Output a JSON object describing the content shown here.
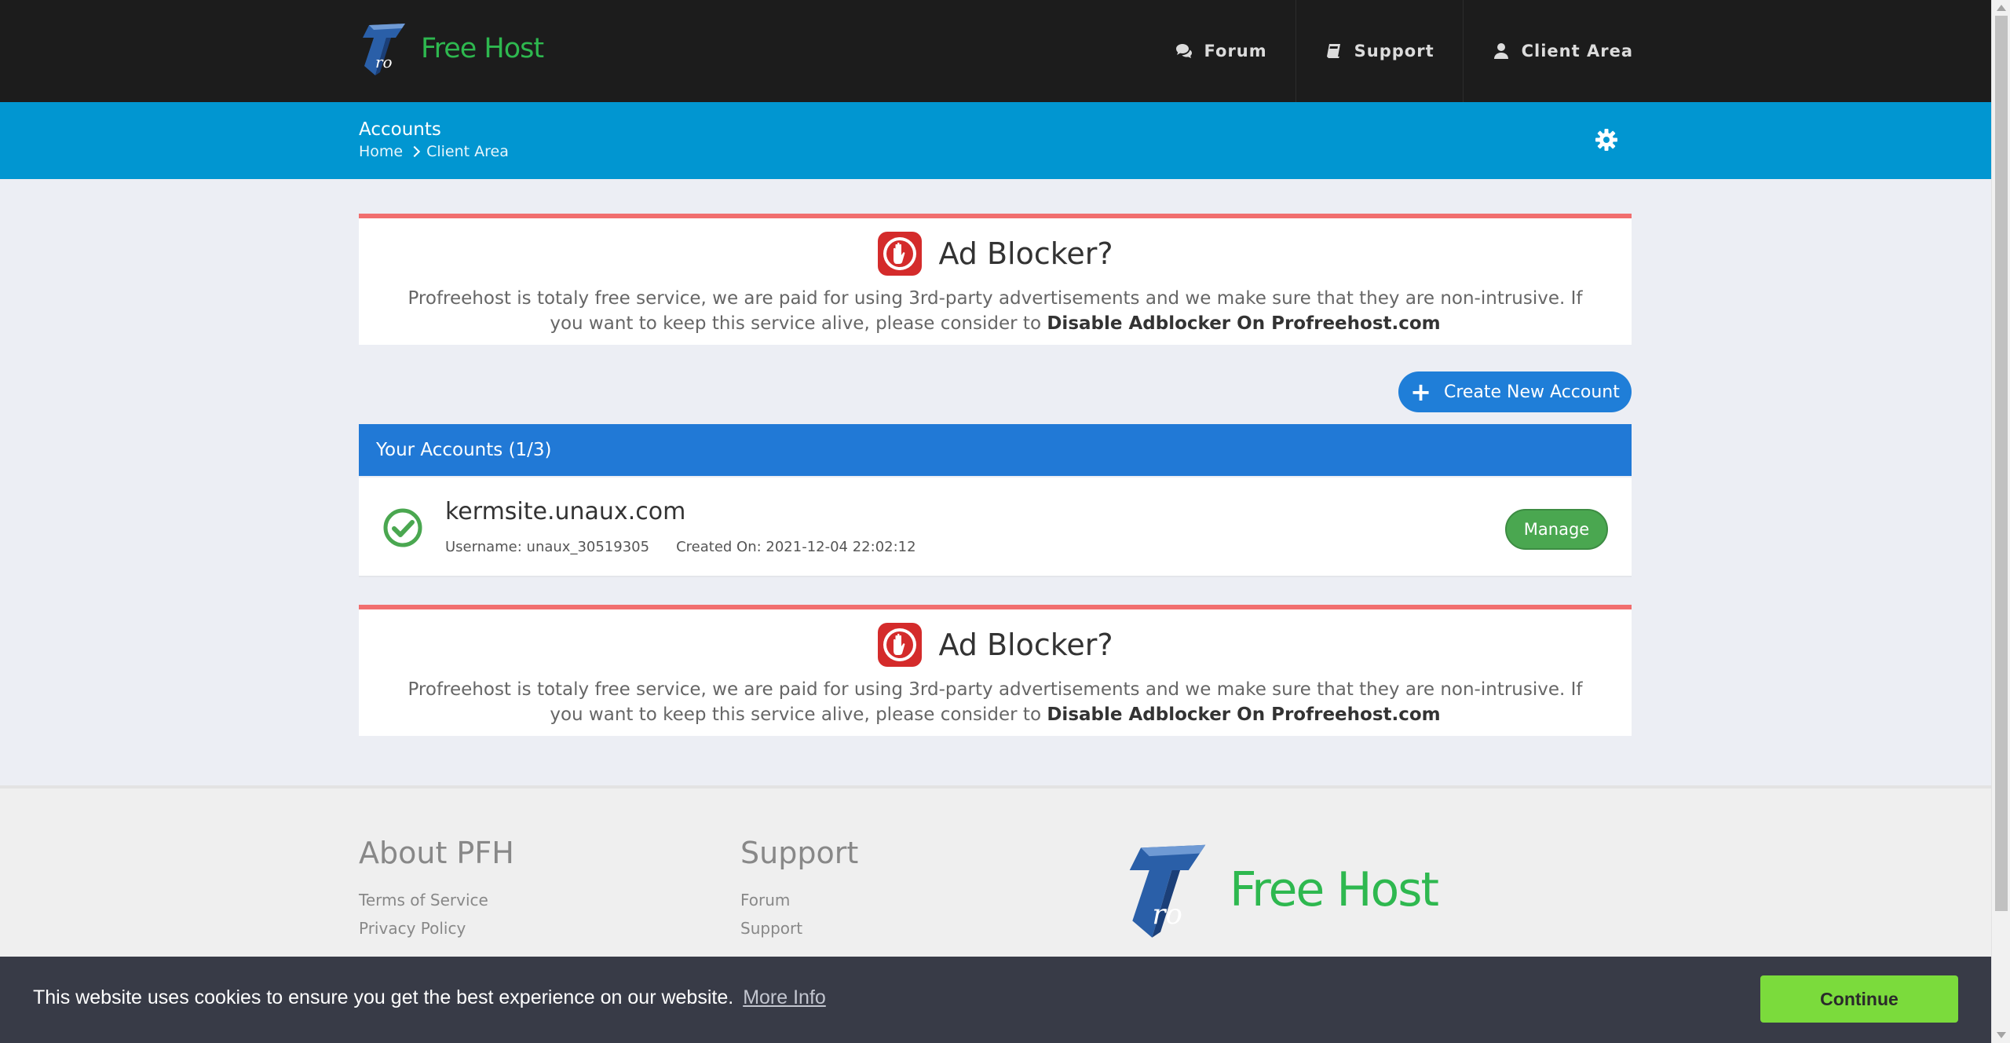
{
  "brand": {
    "logo_mark": "ro",
    "name": "Free Host",
    "color": "#2eb84f"
  },
  "nav": {
    "items": [
      {
        "label": "Forum",
        "icon": "comments-icon"
      },
      {
        "label": "Support",
        "icon": "book-icon"
      },
      {
        "label": "Client Area",
        "icon": "user-icon"
      }
    ]
  },
  "subheader": {
    "title": "Accounts",
    "breadcrumbs": [
      "Home",
      "Client Area"
    ]
  },
  "adblock": {
    "title": "Ad Blocker?",
    "text": "Profreehost is totaly free service, we are paid for using 3rd-party advertisements and we make sure that they are non-intrusive. If you want to keep this service alive, please consider to",
    "strong": "Disable Adblocker On Profreehost.com"
  },
  "accounts": {
    "create_label": "Create New Account",
    "header": "Your Accounts (1/3)",
    "items": [
      {
        "domain": "kermsite.unaux.com",
        "username": "Username: unaux_30519305",
        "created": "Created On: 2021-12-04 22:02:12",
        "status": "active",
        "manage_label": "Manage"
      }
    ]
  },
  "footer": {
    "about": {
      "title": "About PFH",
      "links": [
        "Terms of Service",
        "Privacy Policy"
      ]
    },
    "support": {
      "title": "Support",
      "links": [
        "Forum",
        "Support"
      ]
    }
  },
  "cookie": {
    "message": "This website uses cookies to ensure you get the best experience on our website.",
    "more_info": "More Info",
    "continue": "Continue"
  },
  "colors": {
    "topbar": "#1c1c1c",
    "subbar": "#0196d1",
    "accounts_header": "#2179d6",
    "adblock_border": "#f16e6e",
    "manage": "#4aa750",
    "continue": "#7bdb3c"
  }
}
